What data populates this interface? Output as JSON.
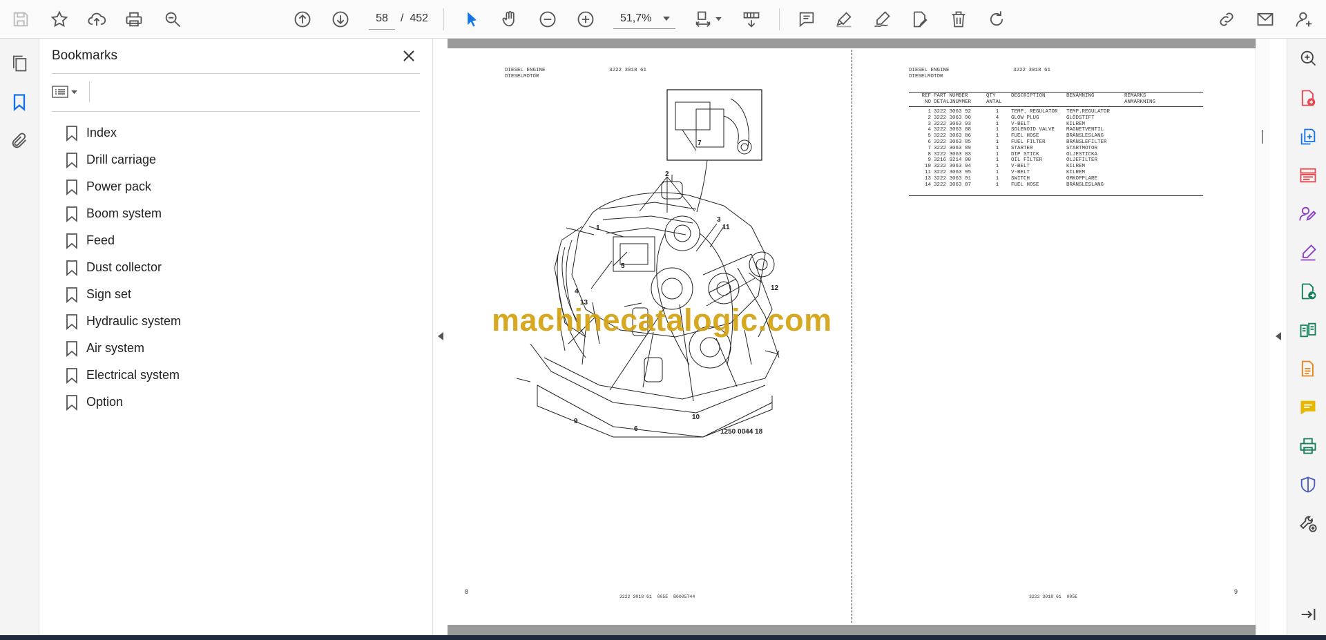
{
  "toolbar": {
    "page_current": "58",
    "page_separator": "/",
    "page_total": "452",
    "zoom": "51,7%",
    "icons": [
      "save-icon",
      "star-icon",
      "upload-icon",
      "print-icon",
      "zoom-search-icon",
      "page-up-icon",
      "page-down-icon",
      "select-cursor-icon",
      "hand-icon",
      "zoom-out-icon",
      "zoom-in-icon",
      "fit-page-icon",
      "scroll-mode-icon",
      "comment-icon",
      "highlight-icon",
      "draw-icon",
      "fill-sign-icon",
      "delete-icon",
      "rotate-icon",
      "share-link-icon",
      "email-icon",
      "account-icon"
    ]
  },
  "bookmarks": {
    "title": "Bookmarks",
    "items": [
      {
        "label": "Index"
      },
      {
        "label": "Drill carriage"
      },
      {
        "label": "Power pack"
      },
      {
        "label": "Boom system"
      },
      {
        "label": "Feed"
      },
      {
        "label": "Dust collector"
      },
      {
        "label": "Sign set"
      },
      {
        "label": "Hydraulic system"
      },
      {
        "label": "Air system"
      },
      {
        "label": "Electrical system"
      },
      {
        "label": "Option"
      }
    ]
  },
  "left_page": {
    "header_title": "DIESEL ENGINE\nDIESELMOTOR",
    "header_code": "3222 3018 61",
    "figure_ref": "1250 0044 18",
    "page_number": "8",
    "footer": "3222 3018 61  005E  B0005744"
  },
  "right_page": {
    "header_title": "DIESEL ENGINE\nDIESELMOTOR",
    "header_code": "3222 3018 61",
    "page_number": "9",
    "footer": "3222 3018 61  005E",
    "columns": {
      "ref": "REF\nNO",
      "part": "PART NUMBER\nDETALJNUMMER",
      "qty": "QTY\nANTAL",
      "desc": "DESCRIPTION",
      "benamning": "BENÄMNING",
      "remarks": "REMARKS\nANMÄRKNING"
    },
    "rows": [
      {
        "ref": "1",
        "part": "3222 3063 92",
        "qty": "1",
        "desc": "TEMP. REGULATOR",
        "sv": "TEMP.REGULATOR"
      },
      {
        "ref": "2",
        "part": "3222 3063 90",
        "qty": "4",
        "desc": "GLOW PLUG",
        "sv": "GLÖDSTIFT"
      },
      {
        "ref": "3",
        "part": "3222 3063 93",
        "qty": "1",
        "desc": "V-BELT",
        "sv": "KILREM"
      },
      {
        "ref": "4",
        "part": "3222 3063 88",
        "qty": "1",
        "desc": "SOLENOID VALVE",
        "sv": "MAGNETVENTIL"
      },
      {
        "ref": "5",
        "part": "3222 3063 86",
        "qty": "1",
        "desc": "FUEL HOSE",
        "sv": "BRÄNSLESLANG"
      },
      {
        "ref": "6",
        "part": "3222 3063 85",
        "qty": "1",
        "desc": "FUEL FILTER",
        "sv": "BRÄNSLEFILTER"
      },
      {
        "ref": "7",
        "part": "3222 3063 89",
        "qty": "1",
        "desc": "STARTER",
        "sv": "STARTMOTOR"
      },
      {
        "ref": "8",
        "part": "3222 3063 83",
        "qty": "1",
        "desc": "DIP STICK",
        "sv": "OLJESTICKA"
      },
      {
        "ref": "9",
        "part": "3216 9214 00",
        "qty": "1",
        "desc": "OIL FILTER",
        "sv": "OLJEFILTER"
      },
      {
        "ref": "10",
        "part": "3222 3063 94",
        "qty": "1",
        "desc": "V-BELT",
        "sv": "KILREM"
      },
      {
        "ref": "11",
        "part": "3222 3063 95",
        "qty": "1",
        "desc": "V-BELT",
        "sv": "KILREM"
      },
      {
        "ref": "13",
        "part": "3222 3063 91",
        "qty": "1",
        "desc": "SWITCH",
        "sv": "OMKOPPLARE"
      },
      {
        "ref": "14",
        "part": "3222 3063 87",
        "qty": "1",
        "desc": "FUEL HOSE",
        "sv": "BRÄNSLESLANG"
      }
    ]
  },
  "watermark": "machinecatalogic.com",
  "figure_callouts": [
    "1",
    "2",
    "3",
    "4",
    "5",
    "6",
    "7",
    "9",
    "10",
    "11",
    "12",
    "13"
  ],
  "right_tools": [
    "search-zoom-tool-icon",
    "export-pdf-icon",
    "create-pdf-icon",
    "organize-pages-icon",
    "request-signature-icon",
    "fill-sign-tool-icon",
    "send-for-review-icon",
    "compare-icon",
    "edit-pdf-icon",
    "comment-tool-icon",
    "print-production-icon",
    "protect-icon",
    "more-tools-icon",
    "expand-panel-icon"
  ],
  "colors": {
    "accent": "#1473e6",
    "watermark": "#d4a10f",
    "pdf_red": "#e34850",
    "purple": "#8a3ec8"
  }
}
